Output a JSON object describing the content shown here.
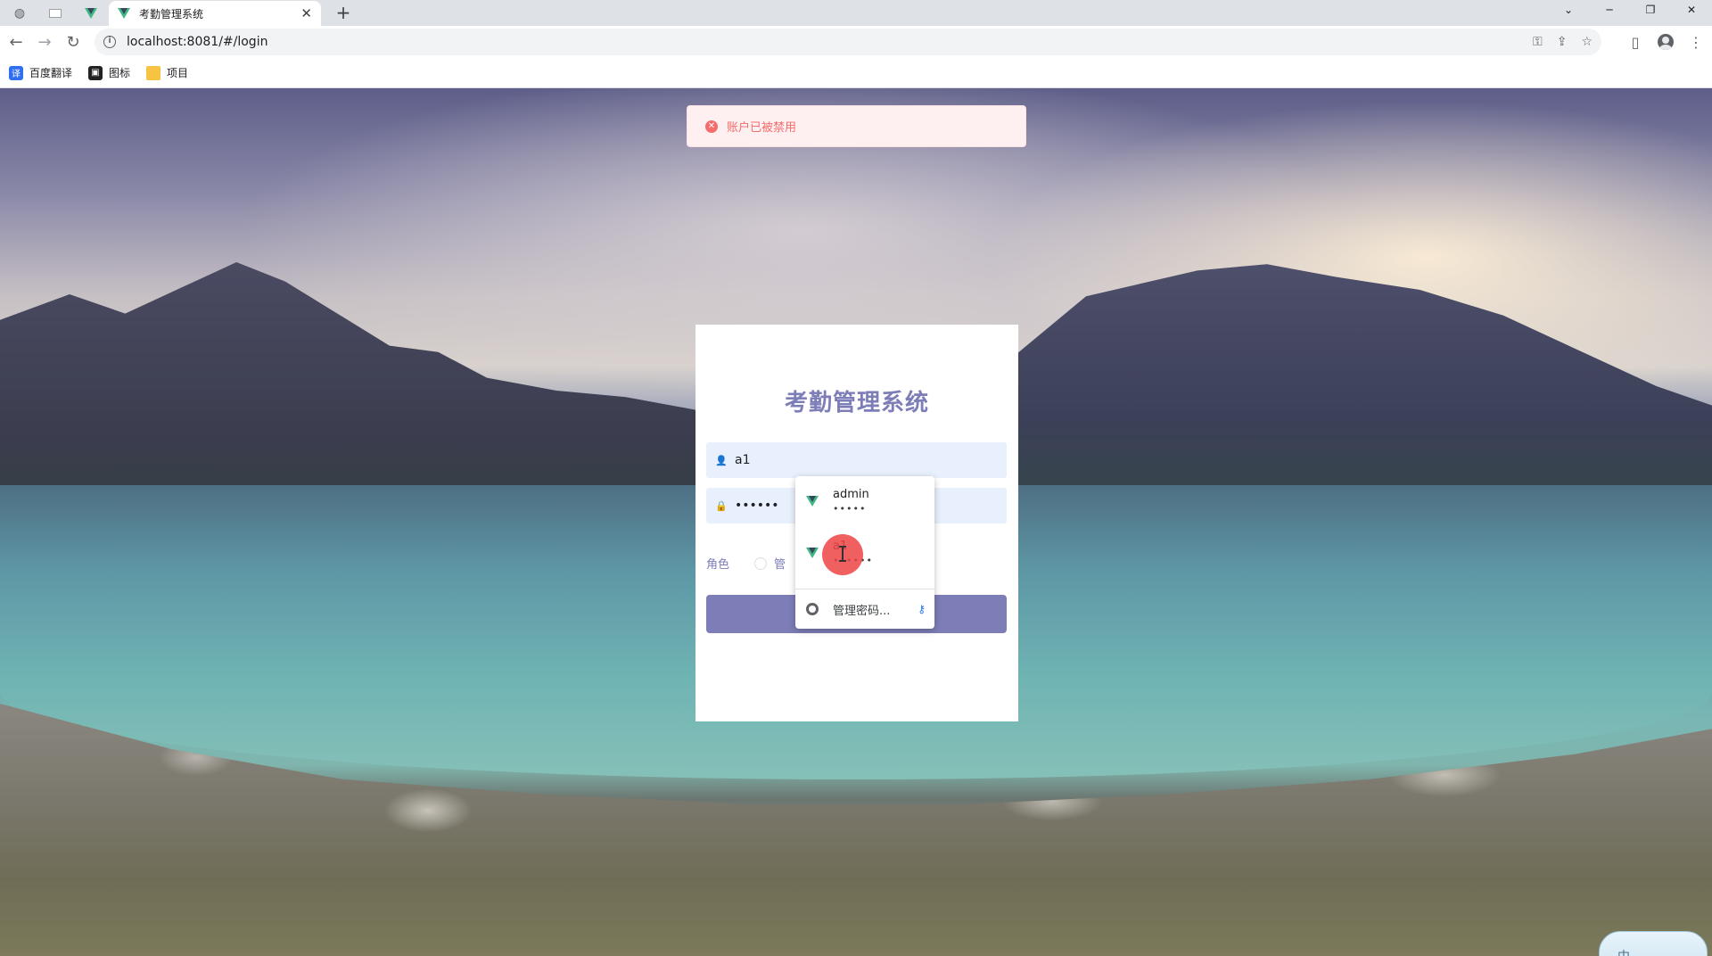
{
  "browser": {
    "tab_title": "考勤管理系统",
    "url": "localhost:8081/#/login",
    "new_tab": "+",
    "close_glyph": "✕",
    "window_controls": [
      "⌄",
      "─",
      "❐",
      "✕"
    ]
  },
  "bookmarks": [
    {
      "label": "百度翻译",
      "icon": "translate-icon",
      "color": "#2f6fef"
    },
    {
      "label": "图标",
      "icon": "bookmark-icon",
      "color": "#222222"
    },
    {
      "label": "项目",
      "icon": "folder-icon",
      "color": "#f6c343"
    }
  ],
  "message": {
    "text": "账户已被禁用",
    "type": "error",
    "color": "#f56c6c"
  },
  "login": {
    "title": "考勤管理系统",
    "username_value": "a1",
    "password_value": "••••••",
    "role_label": "角色",
    "role_option_visible": "管",
    "accent_color": "#7d7db7"
  },
  "autofill": {
    "items": [
      {
        "username": "admin",
        "password": "•••••"
      },
      {
        "username": "a1",
        "password": "••••••"
      }
    ],
    "manage_label": "管理密码..."
  },
  "ime": {
    "label": "中"
  }
}
